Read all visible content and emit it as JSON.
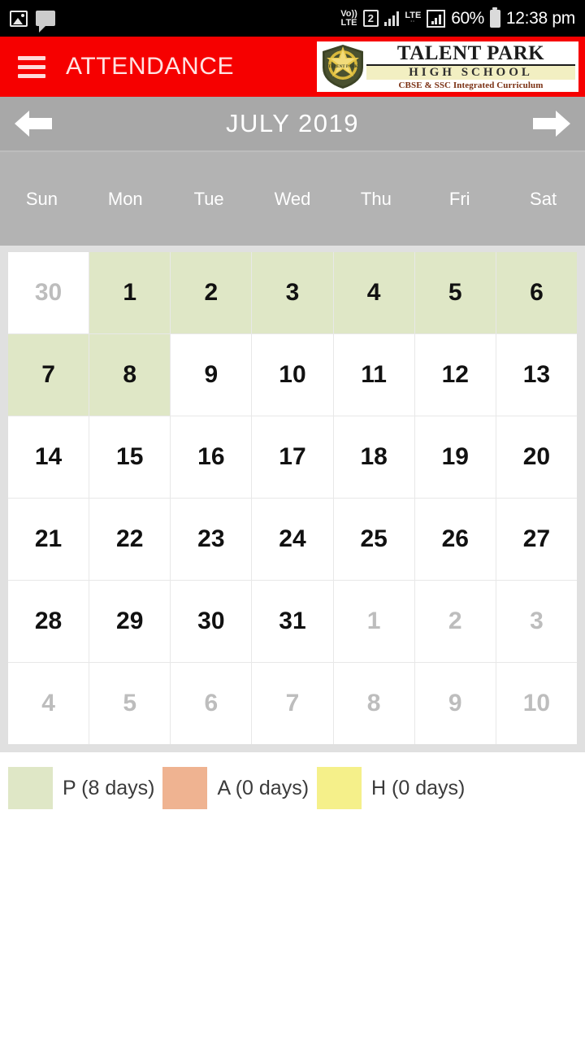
{
  "status_bar": {
    "left_icons": [
      "gallery-icon",
      "chat-icon"
    ],
    "volte_label": "Vo))",
    "volte_sub": "LTE",
    "sim_label": "2",
    "lte_label": "LTE",
    "battery_percent": "60%",
    "time": "12:38 pm"
  },
  "app_bar": {
    "menu_icon": "hamburger-icon",
    "title": "ATTENDANCE",
    "logo": {
      "line1": "TALENT PARK",
      "line2": "HIGH SCHOOL",
      "line3": "CBSE & SSC Integrated Curriculum",
      "badge_text": "TALENT PARK"
    },
    "background_color": "#f60000"
  },
  "month_nav": {
    "prev_icon": "arrow-left-icon",
    "next_icon": "arrow-right-icon",
    "label": "JULY 2019"
  },
  "weekdays": [
    "Sun",
    "Mon",
    "Tue",
    "Wed",
    "Thu",
    "Fri",
    "Sat"
  ],
  "calendar": {
    "cells": [
      {
        "day": "30",
        "state": "other"
      },
      {
        "day": "1",
        "state": "present"
      },
      {
        "day": "2",
        "state": "present"
      },
      {
        "day": "3",
        "state": "present"
      },
      {
        "day": "4",
        "state": "present"
      },
      {
        "day": "5",
        "state": "present"
      },
      {
        "day": "6",
        "state": "present"
      },
      {
        "day": "7",
        "state": "present"
      },
      {
        "day": "8",
        "state": "present"
      },
      {
        "day": "9",
        "state": "normal"
      },
      {
        "day": "10",
        "state": "normal"
      },
      {
        "day": "11",
        "state": "normal"
      },
      {
        "day": "12",
        "state": "normal"
      },
      {
        "day": "13",
        "state": "normal"
      },
      {
        "day": "14",
        "state": "normal"
      },
      {
        "day": "15",
        "state": "normal"
      },
      {
        "day": "16",
        "state": "normal"
      },
      {
        "day": "17",
        "state": "normal"
      },
      {
        "day": "18",
        "state": "normal"
      },
      {
        "day": "19",
        "state": "normal"
      },
      {
        "day": "20",
        "state": "normal"
      },
      {
        "day": "21",
        "state": "normal"
      },
      {
        "day": "22",
        "state": "normal"
      },
      {
        "day": "23",
        "state": "normal"
      },
      {
        "day": "24",
        "state": "normal"
      },
      {
        "day": "25",
        "state": "normal"
      },
      {
        "day": "26",
        "state": "normal"
      },
      {
        "day": "27",
        "state": "normal"
      },
      {
        "day": "28",
        "state": "normal"
      },
      {
        "day": "29",
        "state": "normal"
      },
      {
        "day": "30",
        "state": "normal"
      },
      {
        "day": "31",
        "state": "normal"
      },
      {
        "day": "1",
        "state": "other"
      },
      {
        "day": "2",
        "state": "other"
      },
      {
        "day": "3",
        "state": "other"
      },
      {
        "day": "4",
        "state": "other"
      },
      {
        "day": "5",
        "state": "other"
      },
      {
        "day": "6",
        "state": "other"
      },
      {
        "day": "7",
        "state": "other"
      },
      {
        "day": "8",
        "state": "other"
      },
      {
        "day": "9",
        "state": "other"
      },
      {
        "day": "10",
        "state": "other"
      }
    ]
  },
  "legend": [
    {
      "label": "P (8 days)",
      "color": "#dfe7c6",
      "key": "present"
    },
    {
      "label": "A (0 days)",
      "color": "#efb391",
      "key": "absent"
    },
    {
      "label": "H (0 days)",
      "color": "#f5f08a",
      "key": "holiday"
    }
  ]
}
